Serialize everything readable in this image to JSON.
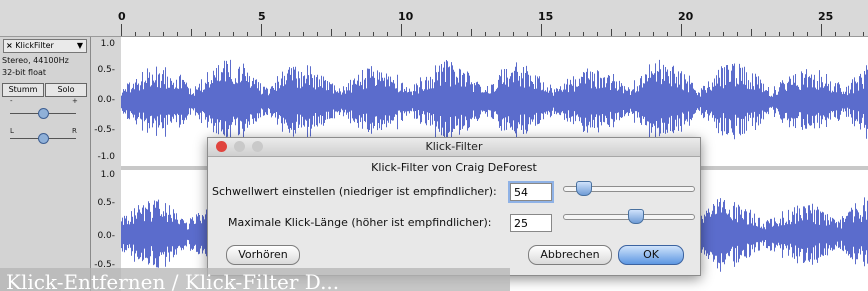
{
  "ruler": {
    "labels": [
      "0",
      "5",
      "10",
      "15",
      "20",
      "25"
    ]
  },
  "track": {
    "name": "KlickFilter",
    "info_line1": "Stereo, 44100Hz",
    "info_line2": "32-bit float",
    "mute_label": "Stumm",
    "solo_label": "Solo",
    "gain_minus": "-",
    "gain_plus": "+",
    "pan_left": "L",
    "pan_right": "R",
    "menu_arrow": "▼",
    "close_glyph": "×"
  },
  "scale": {
    "channel1": [
      "1.0",
      "0.5-",
      "0.0-",
      "-0.5-",
      "-1.0"
    ],
    "channel2": [
      "1.0",
      "0.5-",
      "0.0-",
      "-0.5-"
    ]
  },
  "waveform_color": "#5b6ccc",
  "dialog": {
    "title": "Klick-Filter",
    "heading": "Klick-Filter von Craig DeForest",
    "threshold_label": "Schwellwert einstellen (niedriger ist empfindlicher):",
    "threshold_value": "54",
    "threshold_slider_level": 0.1,
    "width_label": "Maximale Klick-Länge (höher ist empfindlicher):",
    "width_value": "25",
    "width_slider_level": 0.55,
    "preview_button": "Vorhören",
    "cancel_button": "Abbrechen",
    "ok_button": "OK",
    "close_color": "#e0443e",
    "minimize_color": "#c9c9c9",
    "zoom_color": "#c9c9c9"
  },
  "overlay_text": "Klick-Entfernen / Klick-Filter D..."
}
